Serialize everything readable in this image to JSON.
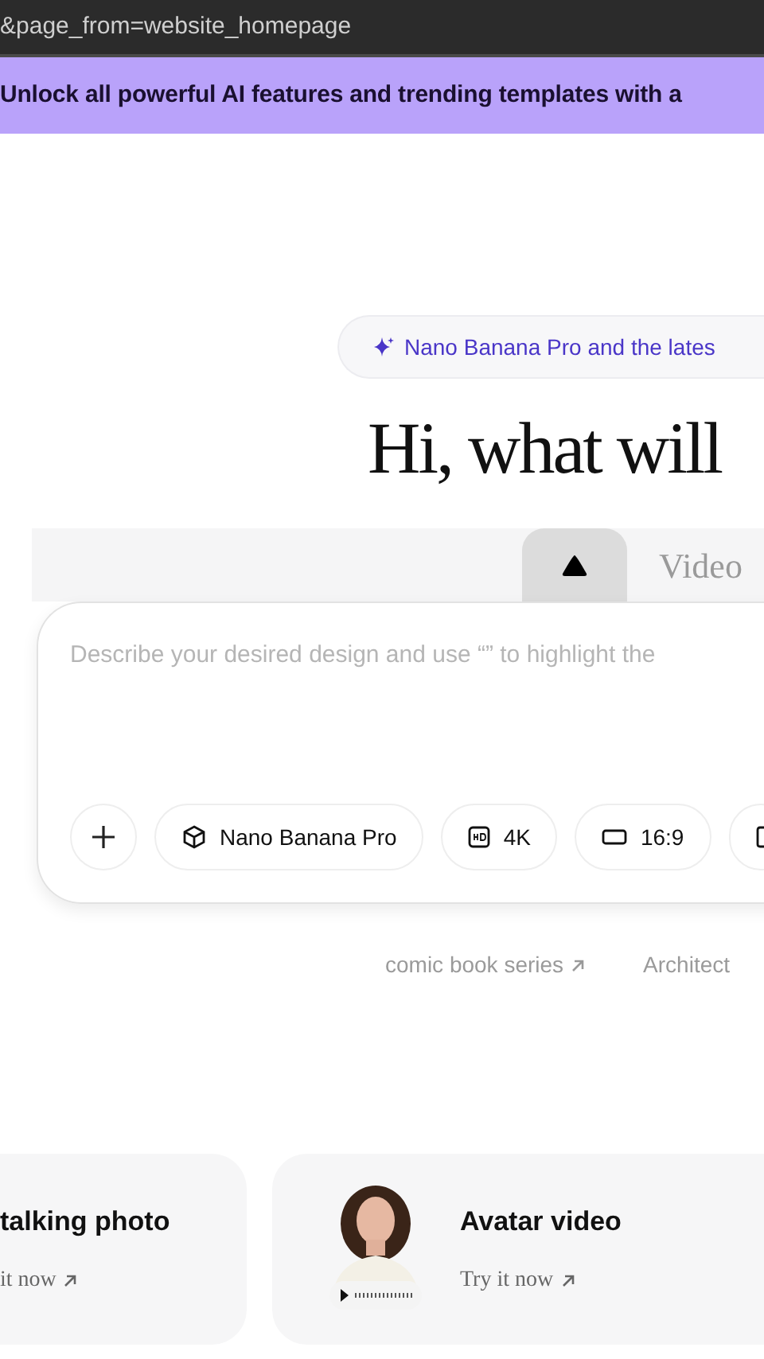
{
  "address_bar": {
    "url": "&page_from=website_homepage"
  },
  "promo_banner": {
    "text": "Unlock all powerful AI features and trending templates with a"
  },
  "announcement": {
    "text": "Nano Banana Pro and the lates"
  },
  "heading": "Hi, what will",
  "tabs": [
    {
      "kind": "icon",
      "selected": true
    },
    {
      "kind": "text",
      "label": "Video",
      "selected": false
    }
  ],
  "prompt": {
    "placeholder": "Describe your desired design and use “” to highlight the"
  },
  "chips": [
    {
      "kind": "add"
    },
    {
      "kind": "model",
      "label": "Nano Banana Pro"
    },
    {
      "kind": "quality",
      "label": "4K"
    },
    {
      "kind": "ratio",
      "label": "16:9"
    },
    {
      "kind": "more"
    }
  ],
  "suggestions": [
    {
      "label": "comic book series",
      "arrow": true
    },
    {
      "label": "Architect",
      "arrow": false
    }
  ],
  "cards": [
    {
      "title": "talking photo",
      "link": "it now",
      "picture": false
    },
    {
      "title": "Avatar video",
      "link": "Try it now",
      "picture": true
    }
  ]
}
